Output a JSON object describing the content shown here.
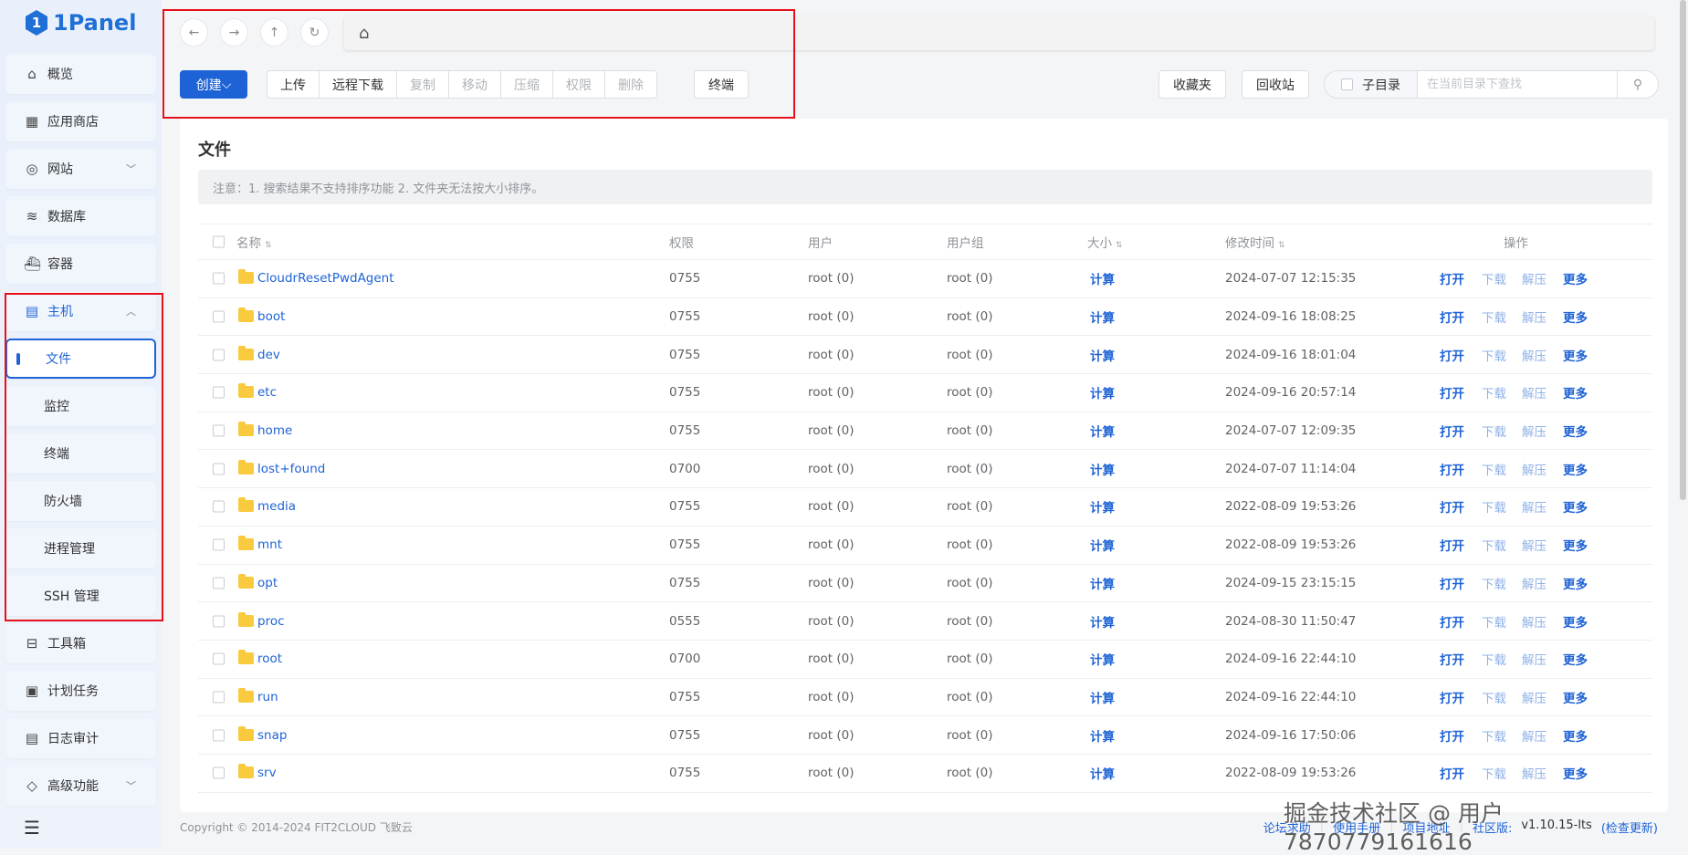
{
  "brand": {
    "name": "1Panel"
  },
  "sidebar": {
    "items": [
      {
        "label": "概览",
        "icon": "home-icon"
      },
      {
        "label": "应用商店",
        "icon": "grid-icon"
      },
      {
        "label": "网站",
        "icon": "globe-icon",
        "chevron": "down"
      },
      {
        "label": "数据库",
        "icon": "layers-icon"
      },
      {
        "label": "容器",
        "icon": "docker-icon"
      },
      {
        "label": "主机",
        "icon": "server-icon",
        "chevron": "up",
        "expanded": true,
        "children": [
          {
            "label": "文件",
            "active": true
          },
          {
            "label": "监控"
          },
          {
            "label": "终端"
          },
          {
            "label": "防火墙"
          },
          {
            "label": "进程管理"
          },
          {
            "label": "SSH 管理"
          }
        ]
      },
      {
        "label": "工具箱",
        "icon": "toolbox-icon"
      },
      {
        "label": "计划任务",
        "icon": "calendar-icon"
      },
      {
        "label": "日志审计",
        "icon": "log-icon"
      },
      {
        "label": "高级功能",
        "icon": "diamond-icon",
        "chevron": "down"
      }
    ]
  },
  "toolbar": {
    "create": "创建",
    "upload": "上传",
    "remote_download": "远程下载",
    "copy": "复制",
    "move": "移动",
    "compress": "压缩",
    "permission": "权限",
    "delete": "删除",
    "terminal": "终端",
    "favorites": "收藏夹",
    "recycle_bin": "回收站",
    "subdir": "子目录",
    "search_placeholder": "在当前目录下查找"
  },
  "main": {
    "title": "文件",
    "notice": "注意：1. 搜索结果不支持排序功能 2. 文件夹无法按大小排序。",
    "columns": {
      "name": "名称",
      "permission": "权限",
      "user": "用户",
      "group": "用户组",
      "size": "大小",
      "modified": "修改时间",
      "actions": "操作"
    },
    "actions": {
      "open": "打开",
      "download": "下载",
      "extract": "解压",
      "more": "更多"
    },
    "rows": [
      {
        "name": "CloudrResetPwdAgent",
        "perm": "0755",
        "user": "root (0)",
        "group": "root (0)",
        "size": "计算",
        "mtime": "2024-07-07 12:15:35"
      },
      {
        "name": "boot",
        "perm": "0755",
        "user": "root (0)",
        "group": "root (0)",
        "size": "计算",
        "mtime": "2024-09-16 18:08:25"
      },
      {
        "name": "dev",
        "perm": "0755",
        "user": "root (0)",
        "group": "root (0)",
        "size": "计算",
        "mtime": "2024-09-16 18:01:04"
      },
      {
        "name": "etc",
        "perm": "0755",
        "user": "root (0)",
        "group": "root (0)",
        "size": "计算",
        "mtime": "2024-09-16 20:57:14"
      },
      {
        "name": "home",
        "perm": "0755",
        "user": "root (0)",
        "group": "root (0)",
        "size": "计算",
        "mtime": "2024-07-07 12:09:35"
      },
      {
        "name": "lost+found",
        "perm": "0700",
        "user": "root (0)",
        "group": "root (0)",
        "size": "计算",
        "mtime": "2024-07-07 11:14:04"
      },
      {
        "name": "media",
        "perm": "0755",
        "user": "root (0)",
        "group": "root (0)",
        "size": "计算",
        "mtime": "2022-08-09 19:53:26"
      },
      {
        "name": "mnt",
        "perm": "0755",
        "user": "root (0)",
        "group": "root (0)",
        "size": "计算",
        "mtime": "2022-08-09 19:53:26"
      },
      {
        "name": "opt",
        "perm": "0755",
        "user": "root (0)",
        "group": "root (0)",
        "size": "计算",
        "mtime": "2024-09-15 23:15:15"
      },
      {
        "name": "proc",
        "perm": "0555",
        "user": "root (0)",
        "group": "root (0)",
        "size": "计算",
        "mtime": "2024-08-30 11:50:47"
      },
      {
        "name": "root",
        "perm": "0700",
        "user": "root (0)",
        "group": "root (0)",
        "size": "计算",
        "mtime": "2024-09-16 22:44:10"
      },
      {
        "name": "run",
        "perm": "0755",
        "user": "root (0)",
        "group": "root (0)",
        "size": "计算",
        "mtime": "2024-09-16 22:44:10"
      },
      {
        "name": "snap",
        "perm": "0755",
        "user": "root (0)",
        "group": "root (0)",
        "size": "计算",
        "mtime": "2024-09-16 17:50:06"
      },
      {
        "name": "srv",
        "perm": "0755",
        "user": "root (0)",
        "group": "root (0)",
        "size": "计算",
        "mtime": "2022-08-09 19:53:26"
      }
    ]
  },
  "footer": {
    "copyright": "Copyright © 2014-2024 FIT2CLOUD 飞致云",
    "forum": "论坛求助",
    "manual": "使用手册",
    "project": "项目地址",
    "edition": "社区版:",
    "version": "v1.10.15-lts",
    "check_update": "(检查更新)"
  },
  "watermark": "掘金技术社区 @ 用户7870779161616",
  "colors": {
    "accent": "#1e63d6",
    "highlight_box": "#e8101a",
    "folder": "#f9c93e"
  }
}
